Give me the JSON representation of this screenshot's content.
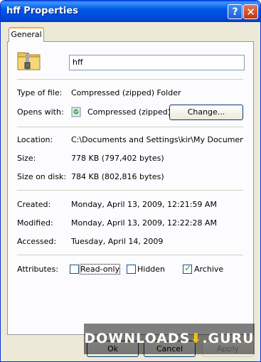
{
  "window": {
    "title": "hff Properties",
    "help": "?",
    "close": "✕"
  },
  "tabs": [
    {
      "label": "General"
    }
  ],
  "file": {
    "name": "hff"
  },
  "labels": {
    "type_of_file": "Type of file:",
    "opens_with": "Opens with:",
    "location": "Location:",
    "size": "Size:",
    "size_on_disk": "Size on disk:",
    "created": "Created:",
    "modified": "Modified:",
    "accessed": "Accessed:",
    "attributes": "Attributes:"
  },
  "values": {
    "type_of_file": "Compressed (zipped) Folder",
    "opens_with": "Compressed (zipped) I",
    "location": "C:\\Documents and Settings\\kir\\My Documents\\Dov",
    "size": "778 KB (797,402 bytes)",
    "size_on_disk": "784 KB (802,816 bytes)",
    "created": "Monday, April 13, 2009, 12:21:59 AM",
    "modified": "Monday, April 13, 2009, 12:22:28 AM",
    "accessed": "Tuesday, April 14, 2009"
  },
  "buttons": {
    "change": "Change...",
    "ok": "Ok",
    "cancel": "Cancel",
    "apply": "Apply"
  },
  "attributes": {
    "read_only": {
      "label": "Read-only",
      "checked": false
    },
    "hidden": {
      "label": "Hidden",
      "checked": false
    },
    "archive": {
      "label": "Archive",
      "checked": true
    }
  },
  "watermark": {
    "left": "DOWNLOADS",
    "arrow": "⬇",
    "right": ".GURU"
  },
  "colors": {
    "titlebar": "#0054e3",
    "tab_accent": "#f5ad3c",
    "dialog": "#ece9d8"
  }
}
